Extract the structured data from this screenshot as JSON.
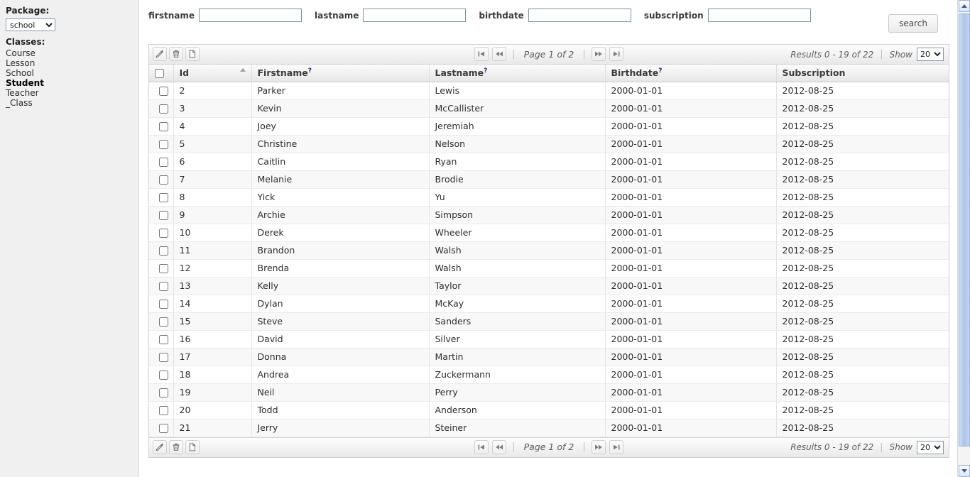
{
  "sidebar": {
    "package_label": "Package:",
    "package_selected": "school",
    "package_options": [
      "school"
    ],
    "classes_label": "Classes:",
    "classes": [
      {
        "label": "Course",
        "active": false
      },
      {
        "label": "Lesson",
        "active": false
      },
      {
        "label": "School",
        "active": false
      },
      {
        "label": "Student",
        "active": true
      },
      {
        "label": "Teacher",
        "active": false
      },
      {
        "label": "_Class",
        "active": false
      }
    ]
  },
  "search": {
    "fields": [
      {
        "label": "firstname",
        "value": "",
        "placeholder": ""
      },
      {
        "label": "lastname",
        "value": "",
        "placeholder": ""
      },
      {
        "label": "birthdate",
        "value": "",
        "placeholder": ""
      },
      {
        "label": "subscription",
        "value": "",
        "placeholder": ""
      }
    ],
    "button_label": "search"
  },
  "toolbar": {
    "edit_icon": "pencil-add-icon",
    "delete_icon": "trash-icon",
    "new_icon": "new-document-icon",
    "first_icon": "first-page-icon",
    "prev_icon": "previous-page-icon",
    "next_icon": "next-page-icon",
    "last_icon": "last-page-icon",
    "page_text": "Page 1 of 2",
    "separator": "|",
    "results_text": "Results 0 - 19 of 22",
    "show_label": "Show",
    "show_selected": "20",
    "show_options": [
      "20"
    ]
  },
  "table": {
    "columns": [
      {
        "key": "check",
        "label": "",
        "sortable": false,
        "hint": false,
        "sorted": ""
      },
      {
        "key": "id",
        "label": "Id",
        "sortable": true,
        "hint": false,
        "sorted": "asc"
      },
      {
        "key": "firstname",
        "label": "Firstname",
        "sortable": true,
        "hint": true,
        "sorted": ""
      },
      {
        "key": "lastname",
        "label": "Lastname",
        "sortable": true,
        "hint": true,
        "sorted": ""
      },
      {
        "key": "birthdate",
        "label": "Birthdate",
        "sortable": true,
        "hint": true,
        "sorted": ""
      },
      {
        "key": "subscription",
        "label": "Subscription",
        "sortable": true,
        "hint": false,
        "sorted": ""
      }
    ],
    "hint_marker": "?",
    "rows": [
      {
        "id": "2",
        "firstname": "Parker",
        "lastname": "Lewis",
        "birthdate": "2000-01-01",
        "subscription": "2012-08-25"
      },
      {
        "id": "3",
        "firstname": "Kevin",
        "lastname": "McCallister",
        "birthdate": "2000-01-01",
        "subscription": "2012-08-25"
      },
      {
        "id": "4",
        "firstname": "Joey",
        "lastname": "Jeremiah",
        "birthdate": "2000-01-01",
        "subscription": "2012-08-25"
      },
      {
        "id": "5",
        "firstname": "Christine",
        "lastname": "Nelson",
        "birthdate": "2000-01-01",
        "subscription": "2012-08-25"
      },
      {
        "id": "6",
        "firstname": "Caitlin",
        "lastname": "Ryan",
        "birthdate": "2000-01-01",
        "subscription": "2012-08-25"
      },
      {
        "id": "7",
        "firstname": "Melanie",
        "lastname": "Brodie",
        "birthdate": "2000-01-01",
        "subscription": "2012-08-25"
      },
      {
        "id": "8",
        "firstname": "Yick",
        "lastname": "Yu",
        "birthdate": "2000-01-01",
        "subscription": "2012-08-25"
      },
      {
        "id": "9",
        "firstname": "Archie",
        "lastname": "Simpson",
        "birthdate": "2000-01-01",
        "subscription": "2012-08-25"
      },
      {
        "id": "10",
        "firstname": "Derek",
        "lastname": "Wheeler",
        "birthdate": "2000-01-01",
        "subscription": "2012-08-25"
      },
      {
        "id": "11",
        "firstname": "Brandon",
        "lastname": "Walsh",
        "birthdate": "2000-01-01",
        "subscription": "2012-08-25"
      },
      {
        "id": "12",
        "firstname": "Brenda",
        "lastname": "Walsh",
        "birthdate": "2000-01-01",
        "subscription": "2012-08-25"
      },
      {
        "id": "13",
        "firstname": "Kelly",
        "lastname": "Taylor",
        "birthdate": "2000-01-01",
        "subscription": "2012-08-25"
      },
      {
        "id": "14",
        "firstname": "Dylan",
        "lastname": "McKay",
        "birthdate": "2000-01-01",
        "subscription": "2012-08-25"
      },
      {
        "id": "15",
        "firstname": "Steve",
        "lastname": "Sanders",
        "birthdate": "2000-01-01",
        "subscription": "2012-08-25"
      },
      {
        "id": "16",
        "firstname": "David",
        "lastname": "Silver",
        "birthdate": "2000-01-01",
        "subscription": "2012-08-25"
      },
      {
        "id": "17",
        "firstname": "Donna",
        "lastname": "Martin",
        "birthdate": "2000-01-01",
        "subscription": "2012-08-25"
      },
      {
        "id": "18",
        "firstname": "Andrea",
        "lastname": "Zuckermann",
        "birthdate": "2000-01-01",
        "subscription": "2012-08-25"
      },
      {
        "id": "19",
        "firstname": "Neil",
        "lastname": "Perry",
        "birthdate": "2000-01-01",
        "subscription": "2012-08-25"
      },
      {
        "id": "20",
        "firstname": "Todd",
        "lastname": "Anderson",
        "birthdate": "2000-01-01",
        "subscription": "2012-08-25"
      },
      {
        "id": "21",
        "firstname": "Jerry",
        "lastname": "Steiner",
        "birthdate": "2000-01-01",
        "subscription": "2012-08-25"
      }
    ]
  },
  "scrollbar": {
    "up_icon": "scroll-up-icon",
    "down_icon": "scroll-down-icon"
  },
  "colors": {
    "sidebar_bg": "#f0f0f0",
    "toolbar_bg": "#eeeeee",
    "hint_marker": "#23237a",
    "scrollbar_thumb": "#aec4e9"
  }
}
